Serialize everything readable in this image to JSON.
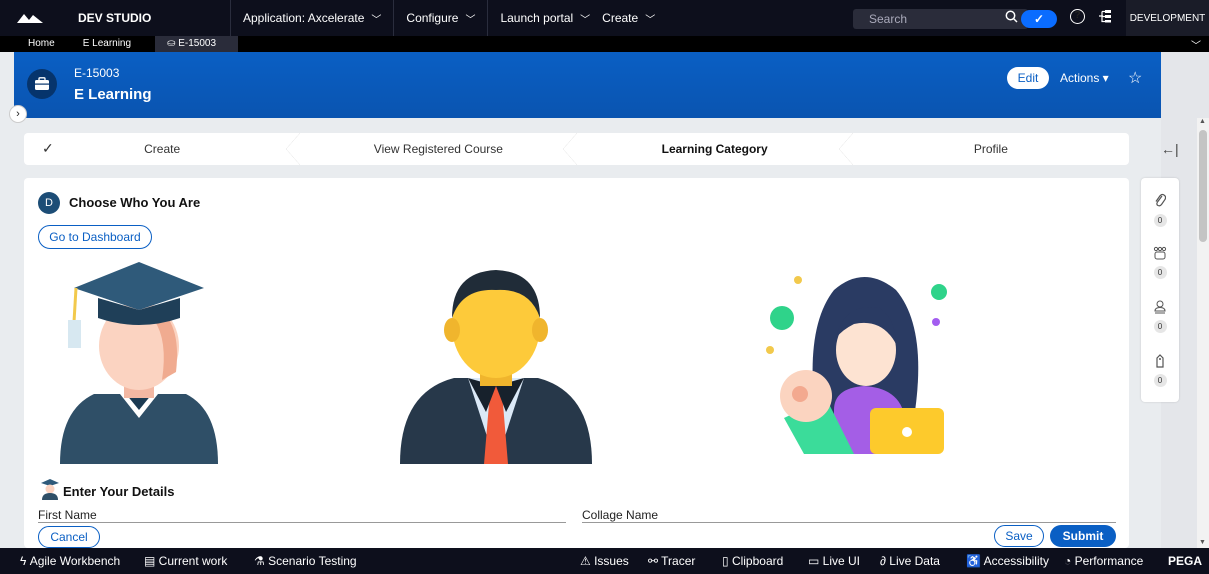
{
  "topbar": {
    "studio": "DEV STUDIO",
    "menus": [
      {
        "label": "Application: Axcelerate"
      },
      {
        "label": "Configure"
      },
      {
        "label": "Launch portal"
      },
      {
        "label": "Create"
      }
    ],
    "search_placeholder": "Search",
    "toggle_check": "✓",
    "help": "?",
    "environment": "DEVELOPMENT"
  },
  "tabs": [
    "Home",
    "E Learning",
    "E-15003"
  ],
  "header": {
    "case_id": "E-15003",
    "case_title": "E Learning",
    "edit_label": "Edit",
    "actions_label": "Actions ▾",
    "star": "☆"
  },
  "stages": [
    "Create",
    "View Registered Course",
    "Learning Category",
    "Profile"
  ],
  "current_stage": "Learning Category",
  "card": {
    "step_letter": "D",
    "section_title": "Choose Who You Are",
    "dashboard_button": "Go to Dashboard",
    "details_title": "Enter Your Details",
    "first_name_label": "First Name",
    "college_label": "Collage Name",
    "cancel_label": "Cancel",
    "save_label": "Save",
    "submit_label": "Submit"
  },
  "utilities": [
    {
      "icon": "paperclip-icon",
      "count": "0"
    },
    {
      "icon": "people-icon",
      "count": "0"
    },
    {
      "icon": "follow-icon",
      "count": "0"
    },
    {
      "icon": "tag-icon",
      "count": "0"
    }
  ],
  "bottombar": {
    "items": [
      "Agile Workbench",
      "Current work",
      "Scenario Testing",
      "Issues",
      "Tracer",
      "Clipboard",
      "Live UI",
      "Live Data",
      "Accessibility",
      "Performance"
    ],
    "brand": "PEGA"
  },
  "colors": {
    "header_blue": "#0a5fc4",
    "dark_bar": "#0d0f1c",
    "accent": "#0a6cff"
  }
}
